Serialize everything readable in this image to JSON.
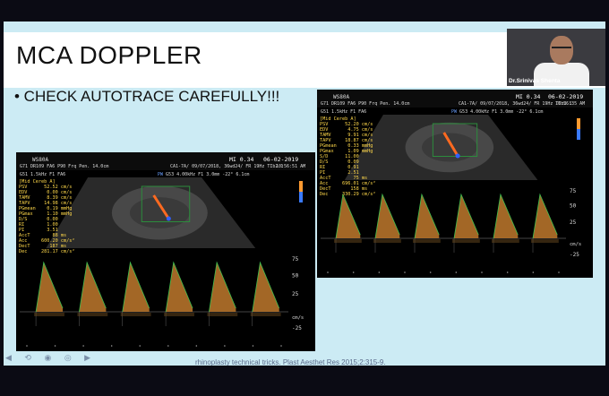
{
  "slide": {
    "title": "MCA DOPPLER",
    "bullet": "• CHECK AUTOTRACE CAREFULLY!!!"
  },
  "webcam": {
    "name": "Dr.Srinivas Shenta"
  },
  "scan_left": {
    "logo": "WS80A",
    "mi": "MI 0.34",
    "date": "06-02-2019",
    "line2a": "G71 DR109 FA6 P90 Frq Pen. 14.0cm",
    "line2b": "CA1-7A/ 09/07/2018, 36wd24/ FR 19Hz  TIb2.1",
    "time": "10:56:51 AM",
    "mode_pw": "PW",
    "mode_text": "G53 4.00kHz F1 3.0mm -22° 6.1cm",
    "mode_sub": "G51 1.5kHz F1 FA6",
    "title": "[Mid Cereb A]",
    "measurements": [
      {
        "k": "PSV",
        "v": "52.52",
        "u": "cm/s"
      },
      {
        "k": "EDV",
        "v": "0.00",
        "u": "cm/s"
      },
      {
        "k": "TAMV",
        "v": "8.39",
        "u": "cm/s"
      },
      {
        "k": "TAPV",
        "v": "14.98",
        "u": "cm/s"
      },
      {
        "k": "PGmean",
        "v": "0.19",
        "u": "mmHg"
      },
      {
        "k": "PGmax",
        "v": "1.10",
        "u": "mmHg"
      },
      {
        "k": "D/S",
        "v": "0.00",
        "u": ""
      },
      {
        "k": "RI",
        "v": "1.00",
        "u": ""
      },
      {
        "k": "PI",
        "v": "3.51",
        "u": ""
      },
      {
        "k": "AccT",
        "v": "88",
        "u": "ms"
      },
      {
        "k": "Acc",
        "v": "600.20",
        "u": "cm/s²"
      },
      {
        "k": "DecT",
        "v": "187",
        "u": "ms"
      },
      {
        "k": "Dec",
        "v": "281.17",
        "u": "cm/s²"
      }
    ],
    "axis_ticks": [
      "75",
      "50",
      "25",
      "-25"
    ],
    "unit": "cm/s"
  },
  "scan_right": {
    "logo": "WS80A",
    "mi": "MI 0.34",
    "date": "06-02-2019",
    "line2a": "G71 DR109 FA6 P90 Frq Pen. 14.0cm",
    "line2b": "CA1-7A/ 09/07/2018, 36wd24/ FR 19Hz  TIb2.1",
    "time": "10:56:35 AM",
    "mode_pw": "PW",
    "mode_text": "G53 4.00kHz F1 3.0mm -22° 6.1cm",
    "mode_sub": "G51 1.5kHz F1 FA6",
    "title": "[Mid Cereb A]",
    "measurements": [
      {
        "k": "PSV",
        "v": "52.20",
        "u": "cm/s"
      },
      {
        "k": "EDV",
        "v": "4.75",
        "u": "cm/s"
      },
      {
        "k": "TAMV",
        "v": "9.91",
        "u": "cm/s"
      },
      {
        "k": "TAPV",
        "v": "18.87",
        "u": "cm/s"
      },
      {
        "k": "PGmean",
        "v": "0.33",
        "u": "mmHg"
      },
      {
        "k": "PGmax",
        "v": "1.09",
        "u": "mmHg"
      },
      {
        "k": "S/D",
        "v": "11.00",
        "u": ""
      },
      {
        "k": "D/S",
        "v": "0.09",
        "u": ""
      },
      {
        "k": "RI",
        "v": "0.91",
        "u": ""
      },
      {
        "k": "PI",
        "v": "2.51",
        "u": ""
      },
      {
        "k": "AccT",
        "v": "75",
        "u": "ms"
      },
      {
        "k": "Acc",
        "v": "696.01",
        "u": "cm/s²"
      },
      {
        "k": "DecT",
        "v": "158",
        "u": "ms"
      },
      {
        "k": "Dec",
        "v": "330.29",
        "u": "cm/s²"
      }
    ],
    "axis_ticks": [
      "75",
      "50",
      "25",
      "-25"
    ],
    "unit": "cm/s"
  },
  "footer_citation": "rhinoplasty technical tricks. Plast Aesthet Res 2015;2:315-9."
}
